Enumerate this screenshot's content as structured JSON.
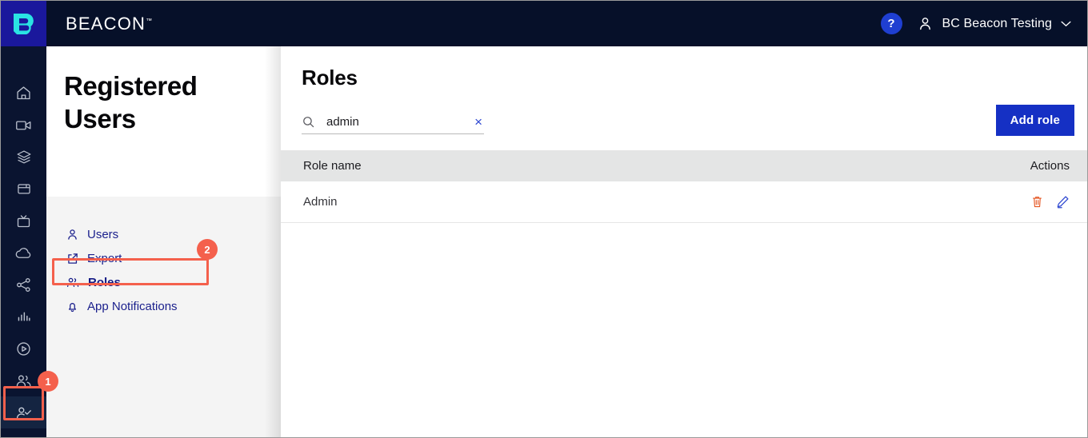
{
  "topbar": {
    "logo_icon": "beacon-b-logo",
    "brand": "BEACON",
    "trademark": "™",
    "help_label": "?",
    "user_name": "BC Beacon Testing",
    "user_icon": "person-icon",
    "chevron_icon": "chevron-down-icon"
  },
  "rail": {
    "items": [
      {
        "icon": "home-icon",
        "name": "home"
      },
      {
        "icon": "video-camera-icon",
        "name": "live-video"
      },
      {
        "icon": "layers-icon",
        "name": "layers"
      },
      {
        "icon": "wallet-icon",
        "name": "wallet"
      },
      {
        "icon": "tv-icon",
        "name": "tv"
      },
      {
        "icon": "cloud-icon",
        "name": "cloud"
      },
      {
        "icon": "share-nodes-icon",
        "name": "share"
      },
      {
        "icon": "bar-chart-icon",
        "name": "analytics"
      },
      {
        "icon": "play-circle-icon",
        "name": "playback"
      },
      {
        "icon": "users-icon",
        "name": "audience"
      },
      {
        "icon": "user-check-icon",
        "name": "registered-users"
      }
    ],
    "active_index": 10,
    "badge": "1"
  },
  "leftpanel": {
    "heading": "Registered Users",
    "nav": [
      {
        "label": "Users",
        "icon": "person-icon",
        "active": false
      },
      {
        "label": "Export",
        "icon": "export-icon",
        "active": false
      },
      {
        "label": "Roles",
        "icon": "users-icon",
        "active": true
      },
      {
        "label": "App Notifications",
        "icon": "bell-icon",
        "active": false
      }
    ],
    "badge": "2"
  },
  "main": {
    "title": "Roles",
    "search": {
      "value": "admin",
      "placeholder": "",
      "icon": "search-icon",
      "clear_label": "×"
    },
    "add_button": "Add role",
    "table": {
      "columns": [
        "Role name",
        "Actions"
      ],
      "rows": [
        {
          "name": "Admin",
          "actions": [
            "delete-icon",
            "edit-icon"
          ]
        }
      ]
    }
  },
  "colors": {
    "topbar_bg": "#061029",
    "rail_bg": "#0a1430",
    "logo_bg": "#1a189c",
    "accent_blue": "#1530c4",
    "nav_blue": "#1a1f8c",
    "highlight_coral": "#f4604c",
    "delete_orange": "#e4531f",
    "edit_blue": "#2b45d0",
    "table_header_bg": "#e4e5e5",
    "panel_bg": "#f4f4f4"
  }
}
